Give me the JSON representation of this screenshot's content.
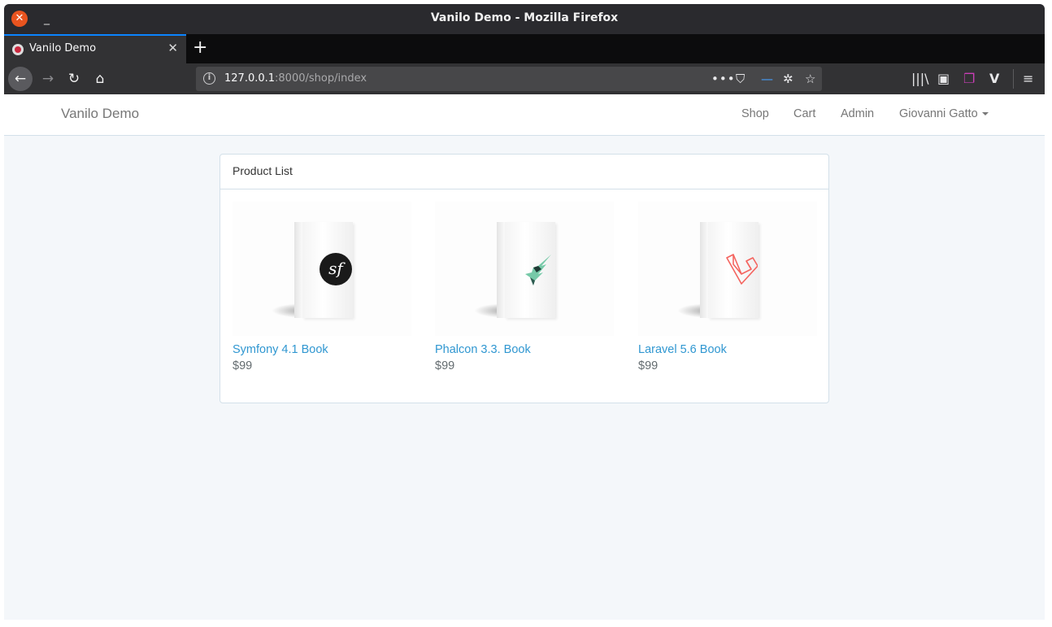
{
  "window": {
    "title": "Vanilo Demo - Mozilla Firefox",
    "close_glyph": "✕",
    "minimize_glyph": "_"
  },
  "tabs": [
    {
      "label": "Vanilo Demo",
      "close_glyph": "✕"
    }
  ],
  "newtab_glyph": "+",
  "toolbar": {
    "back_glyph": "←",
    "forward_glyph": "→",
    "reload_glyph": "↻",
    "home_glyph": "⌂",
    "url_host": "127.0.0.1",
    "url_rest": ":8000/shop/index",
    "info_glyph": "i",
    "page_actions_glyph": "•••",
    "pocket_glyph": "⛉",
    "dash_glyph": "—",
    "bug_glyph": "✲",
    "bookmark_glyph": "☆",
    "library_glyph": "|||\\",
    "sidebar_glyph": "▣",
    "container_glyph": "❐",
    "vue_glyph": "V",
    "menu_glyph": "≡"
  },
  "app": {
    "brand": "Vanilo Demo",
    "nav": {
      "shop": "Shop",
      "cart": "Cart",
      "admin": "Admin",
      "user": "Giovanni Gatto"
    }
  },
  "panel": {
    "heading": "Product List"
  },
  "products": [
    {
      "name": "Symfony 4.1 Book",
      "price": "$99",
      "logo": "symfony-logo",
      "logo_text": "sf"
    },
    {
      "name": "Phalcon 3.3. Book",
      "price": "$99",
      "logo": "phalcon-logo"
    },
    {
      "name": "Laravel 5.6 Book",
      "price": "$99",
      "logo": "laravel-logo"
    }
  ],
  "colors": {
    "link": "#3097d1",
    "accent_tab": "#0a84ff",
    "close_button": "#e9541f",
    "laravel": "#f4645f",
    "phalcon": "#76c9a8"
  }
}
